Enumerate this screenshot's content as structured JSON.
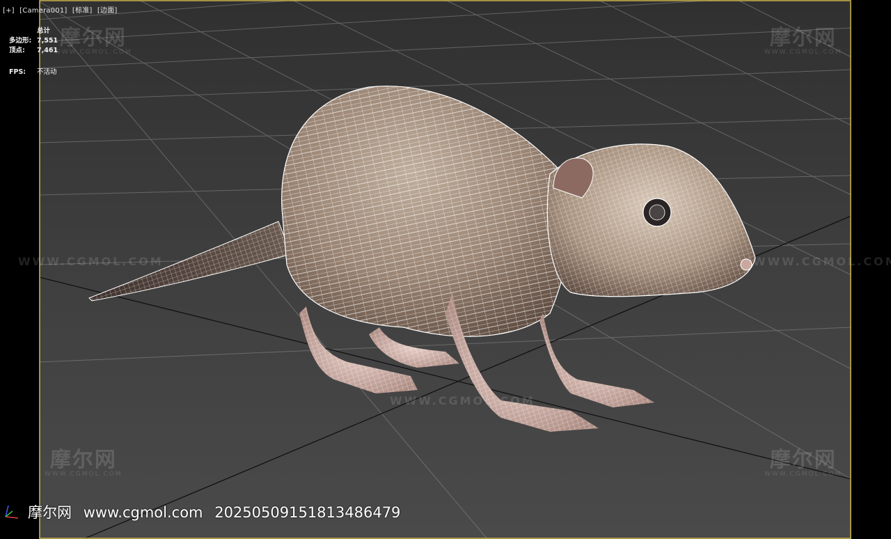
{
  "viewport": {
    "label_plus": "[+]",
    "label_camera": "[Camera001]",
    "label_shading": "[标准]",
    "label_mode": "[边面]"
  },
  "stats": {
    "title": "总计",
    "polygons_label": "多边形:",
    "polygons_value": "7,551",
    "vertices_label": "顶点:",
    "vertices_value": "7,461",
    "fps_label": "FPS:",
    "fps_value": "不活动"
  },
  "watermark": {
    "logo_text": "摩尔网",
    "logo_url": "WWW.CGMOL.COM",
    "line_text": "WWW.CGMOL.COM"
  },
  "footer": {
    "site_name": "摩尔网",
    "site_url": "www.cgmol.com",
    "id": "20250509151813486479"
  },
  "colors": {
    "viewport_border": "#c8b24a",
    "background": "#3a3a3a",
    "grid_line": "#8a8a8a",
    "wireframe": "#ffffff",
    "fur": "#a08a78"
  }
}
